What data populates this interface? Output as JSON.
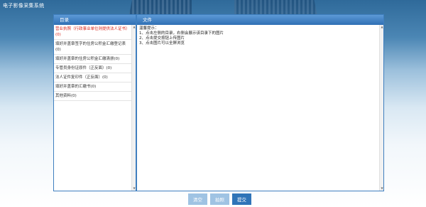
{
  "app": {
    "title": "电子影像采集系统"
  },
  "directory": {
    "header": "目录",
    "items": [
      {
        "label": "营业执照（行政事业单位则提供法人证书）(0)",
        "active": true
      },
      {
        "label": "填好并盖章签字的住房公积金汇缴登记表(0)",
        "active": false
      },
      {
        "label": "填好并盖章的住房公积金汇缴清册(0)",
        "active": false
      },
      {
        "label": "专管员身份证原件（正反面）(0)",
        "active": false
      },
      {
        "label": "法人证件复印件（正反面）(0)",
        "active": false
      },
      {
        "label": "填好并盖章的汇缴书(0)",
        "active": false
      },
      {
        "label": "其他资料(0)",
        "active": false
      }
    ]
  },
  "file": {
    "header": "文件",
    "tips": [
      "温馨提示：",
      "1、点击左侧的目录，右侧会展示该目录下的图片",
      "2、点击提交按钮上传图片",
      "3、点击图片可以全屏浏览"
    ]
  },
  "buttons": {
    "clear": "清空",
    "shoot": "拍照",
    "submit": "提交"
  },
  "colors": {
    "header_blue": "#2f6fb4",
    "active_item_red": "#d9261c",
    "submit_blue": "#2f74b8",
    "disabled_blue": "#9fc3e3"
  }
}
